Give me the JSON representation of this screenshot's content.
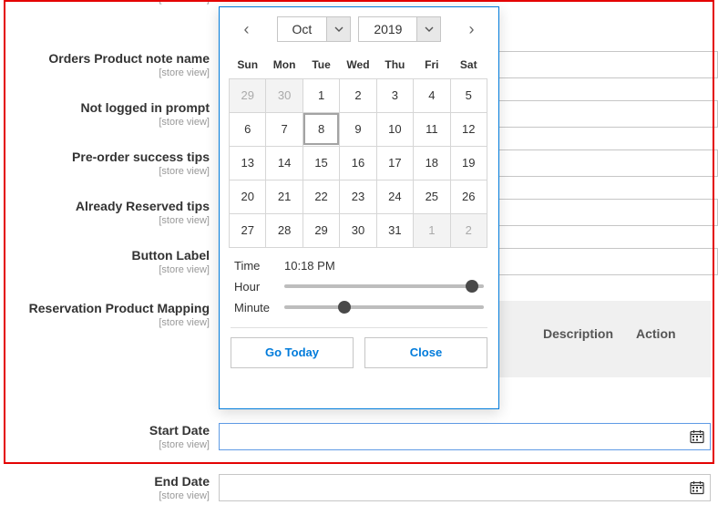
{
  "scope_label": "[store view]",
  "fields": {
    "field0": {
      "label": "Orders Product note name"
    },
    "field1": {
      "label": "Not logged in prompt"
    },
    "field2": {
      "label": "Pre-order success tips"
    },
    "field3": {
      "label": "Already Reserved tips"
    },
    "field4": {
      "label": "Button Label"
    },
    "mapping": {
      "label": "Reservation Product Mapping"
    },
    "start": {
      "label": "Start Date"
    },
    "end": {
      "label": "End Date"
    }
  },
  "mapping_header": {
    "description": "Description",
    "action": "Action"
  },
  "datepicker": {
    "month": "Oct",
    "year": "2019",
    "days": [
      "Sun",
      "Mon",
      "Tue",
      "Wed",
      "Thu",
      "Fri",
      "Sat"
    ],
    "grid": [
      [
        {
          "n": "29",
          "out": true
        },
        {
          "n": "30",
          "out": true
        },
        {
          "n": "1"
        },
        {
          "n": "2"
        },
        {
          "n": "3"
        },
        {
          "n": "4"
        },
        {
          "n": "5"
        }
      ],
      [
        {
          "n": "6"
        },
        {
          "n": "7"
        },
        {
          "n": "8",
          "today": true
        },
        {
          "n": "9"
        },
        {
          "n": "10"
        },
        {
          "n": "11"
        },
        {
          "n": "12"
        }
      ],
      [
        {
          "n": "13"
        },
        {
          "n": "14"
        },
        {
          "n": "15"
        },
        {
          "n": "16"
        },
        {
          "n": "17"
        },
        {
          "n": "18"
        },
        {
          "n": "19"
        }
      ],
      [
        {
          "n": "20"
        },
        {
          "n": "21"
        },
        {
          "n": "22"
        },
        {
          "n": "23"
        },
        {
          "n": "24"
        },
        {
          "n": "25"
        },
        {
          "n": "26"
        }
      ],
      [
        {
          "n": "27"
        },
        {
          "n": "28"
        },
        {
          "n": "29"
        },
        {
          "n": "30"
        },
        {
          "n": "31"
        },
        {
          "n": "1",
          "out": true
        },
        {
          "n": "2",
          "out": true
        }
      ]
    ],
    "time_label": "Time",
    "time_value": "10:18 PM",
    "hour_label": "Hour",
    "minute_label": "Minute",
    "hour_pct": 94,
    "minute_pct": 30,
    "go_today": "Go Today",
    "close": "Close"
  }
}
